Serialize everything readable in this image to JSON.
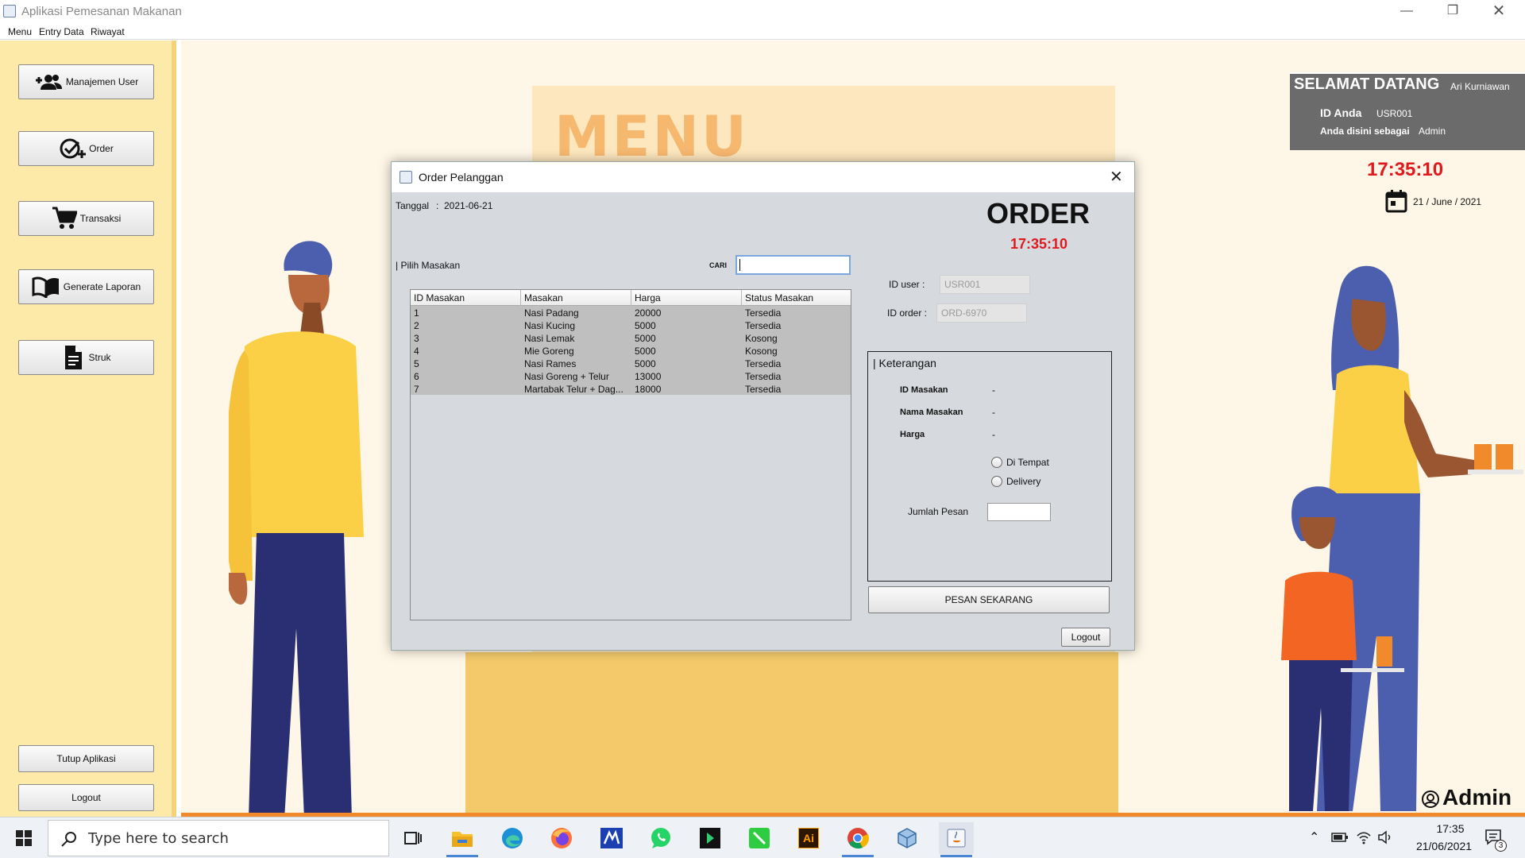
{
  "window": {
    "title": "Aplikasi Pemesanan Makanan",
    "controls": [
      "minimize",
      "restore",
      "close"
    ]
  },
  "menubar": {
    "items": [
      "Menu",
      "Entry Data",
      "Riwayat"
    ]
  },
  "sidebar": {
    "buttons": [
      {
        "label": "Manajemen User",
        "icon": "add-user-icon"
      },
      {
        "label": "Order",
        "icon": "check-add-icon"
      },
      {
        "label": "Transaksi",
        "icon": "cart-icon"
      },
      {
        "label": "Generate Laporan",
        "icon": "book-icon"
      },
      {
        "label": "Struk",
        "icon": "document-icon"
      }
    ],
    "tutup_label": "Tutup Aplikasi",
    "logout_label": "Logout"
  },
  "background": {
    "menu_word": "MENU"
  },
  "welcome": {
    "greeting": "SELAMAT DATANG",
    "user_name": "Ari Kurniawan",
    "id_label": "ID Anda",
    "id_value": "USR001",
    "role_label": "Anda disini sebagai",
    "role_value": "Admin",
    "clock": "17:35:10",
    "date": "21 / June / 2021",
    "footer_role": "Admin"
  },
  "dialog": {
    "title": "Order Pelanggan",
    "tanggal_label": "Tanggal",
    "tanggal_sep": ":",
    "tanggal_value": "2021-06-21",
    "heading": "ORDER",
    "clock": "17:35:10",
    "pilih_label": "| Pilih Masakan",
    "cari_label": "CARI",
    "cari_value": "",
    "table": {
      "columns": [
        "ID Masakan",
        "Masakan",
        "Harga",
        "Status Masakan"
      ],
      "rows": [
        [
          "1",
          "Nasi Padang",
          "20000",
          "Tersedia"
        ],
        [
          "2",
          "Nasi Kucing",
          "5000",
          "Tersedia"
        ],
        [
          "3",
          "Nasi Lemak",
          "5000",
          "Kosong"
        ],
        [
          "4",
          "Mie Goreng",
          "5000",
          "Kosong"
        ],
        [
          "5",
          "Nasi Rames",
          "5000",
          "Tersedia"
        ],
        [
          "6",
          "Nasi Goreng + Telur",
          "13000",
          "Tersedia"
        ],
        [
          "7",
          "Martabak Telur + Dag...",
          "18000",
          "Tersedia"
        ]
      ]
    },
    "id_user_label": "ID user :",
    "id_user_value": "USR001",
    "id_order_label": "ID order :",
    "id_order_value": "ORD-6970",
    "keterangan": {
      "title": "| Keterangan",
      "id_masakan_label": "ID Masakan",
      "id_masakan_value": "-",
      "nama_label": "Nama Masakan",
      "nama_value": "-",
      "harga_label": "Harga",
      "harga_value": "-",
      "radio_ditempat": "Di Tempat",
      "radio_delivery": "Delivery",
      "jumlah_label": "Jumlah Pesan",
      "jumlah_value": ""
    },
    "pesan_button": "PESAN SEKARANG",
    "logout_button": "Logout"
  },
  "taskbar": {
    "search_placeholder": "Type here to search",
    "apps": [
      "task-view-icon",
      "file-explorer-icon",
      "edge-icon",
      "firefox-icon",
      "app-m-icon",
      "whatsapp-icon",
      "app-dark-icon",
      "app-green-icon",
      "illustrator-icon",
      "chrome-icon",
      "app-cube-icon",
      "java-icon"
    ],
    "illustrator_text": "Ai",
    "time": "17:35",
    "date": "21/06/2021",
    "notification_count": "3"
  }
}
